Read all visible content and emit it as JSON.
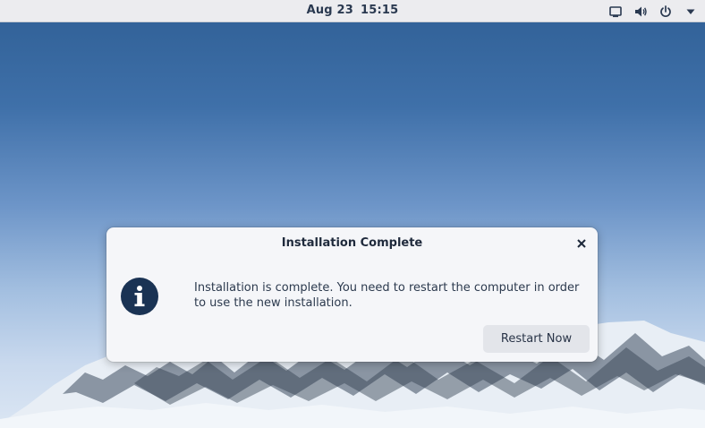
{
  "topbar": {
    "date": "Aug 23",
    "time": "15:15",
    "tray_icons": [
      "display-icon",
      "volume-icon",
      "power-icon",
      "menu-arrow-icon"
    ]
  },
  "dialog": {
    "title": "Installation Complete",
    "message": "Installation is complete. You need to restart the computer in order to use the new installation.",
    "icon": "info-icon",
    "restart_label": "Restart Now",
    "close_icon": "close-icon"
  },
  "colors": {
    "topbar_bg": "#ececef",
    "dialog_bg": "#f5f6f9",
    "accent_dark": "#1a3354",
    "button_bg": "#e3e5ea"
  }
}
